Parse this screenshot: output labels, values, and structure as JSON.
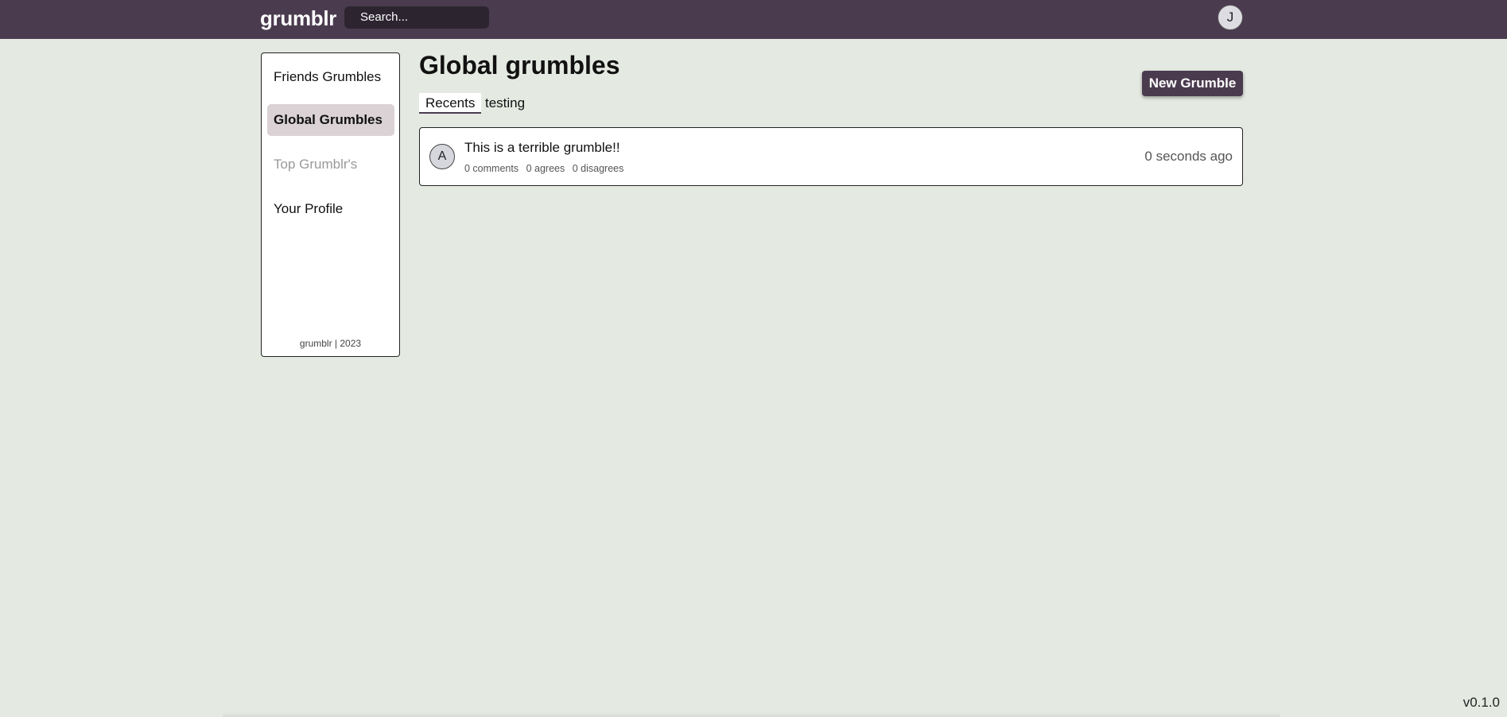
{
  "header": {
    "logo": "grumblr",
    "search_placeholder": "Search...",
    "user_initial": "J"
  },
  "sidebar": {
    "items": [
      {
        "label": "Friends Grumbles",
        "state": "normal"
      },
      {
        "label": "Global Grumbles",
        "state": "active"
      },
      {
        "label": "Top Grumblr's",
        "state": "disabled"
      },
      {
        "label": "Your Profile",
        "state": "normal"
      }
    ],
    "footer": "grumblr | 2023"
  },
  "main": {
    "title": "Global grumbles",
    "tabs": [
      {
        "label": "Recents",
        "active": true
      },
      {
        "label": "testing",
        "active": false
      }
    ],
    "new_button_label": "New Grumble",
    "grumbles": [
      {
        "author_initial": "A",
        "text": "This is a terrible grumble!!",
        "comments": "0 comments",
        "agrees": "0 agrees",
        "disagrees": "0 disagrees",
        "time": "0 seconds ago"
      }
    ]
  },
  "version": "v0.1.0",
  "colors": {
    "brand": "#4b3b4f",
    "background": "#e4e9e2",
    "active_nav": "#dbd2d6"
  }
}
